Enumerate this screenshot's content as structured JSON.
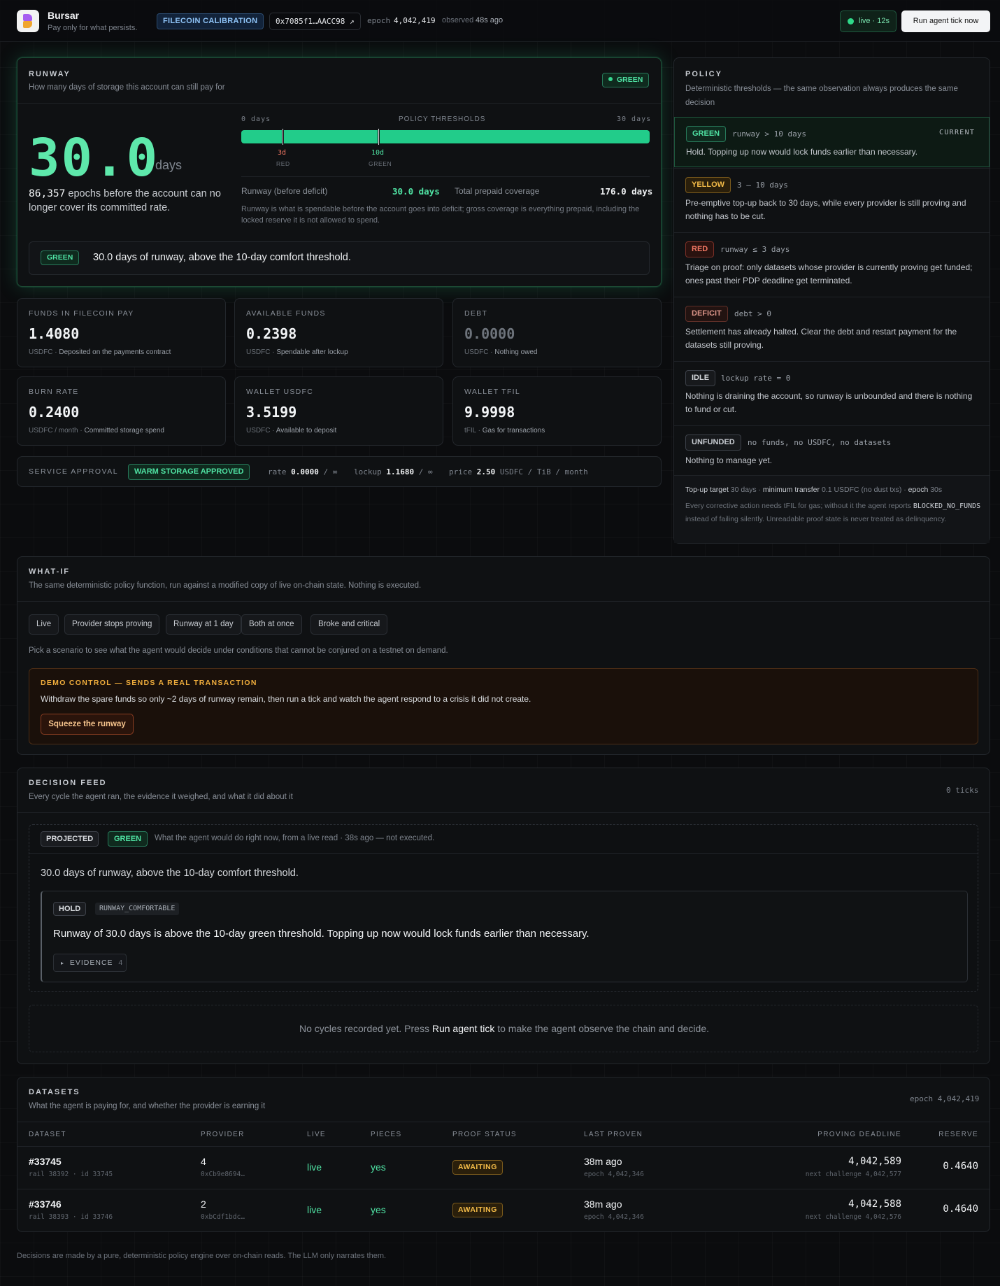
{
  "header": {
    "brand": "Bursar",
    "tagline": "Pay only for what persists.",
    "network": "FILECOIN CALIBRATION",
    "address": "0x7085f1…AACC98 ↗",
    "epoch_label": "epoch",
    "epoch": "4,042,419",
    "observed_label": "observed",
    "observed": "48s ago",
    "live": "live · 12s",
    "run_button": "Run agent tick now"
  },
  "runway": {
    "title": "RUNWAY",
    "subtitle": "How many days of storage this account can still pay for",
    "status": "GREEN",
    "days": "30.0",
    "days_unit": "days",
    "epochs": "86,357",
    "epochs_text": " epochs before the account can no longer cover its committed rate.",
    "thresholds_label": "POLICY THRESHOLDS",
    "min_label": "0 days",
    "max_label": "30 days",
    "fill_fraction": 1.0,
    "red_tick": "3d",
    "red_tick_sub": "RED",
    "green_tick": "10d",
    "green_tick_sub": "GREEN",
    "before_deficit_label": "Runway (before deficit)",
    "before_deficit": "30.0 days",
    "prepaid_label": "Total prepaid coverage",
    "prepaid": "176.0 days",
    "note": "Runway is what is spendable before the account goes into deficit; gross coverage is everything prepaid, including the locked reserve it is not allowed to spend.",
    "banner_tag": "GREEN",
    "banner_text": "30.0 days of runway, above the 10-day comfort threshold."
  },
  "stats": [
    {
      "label": "FUNDS IN FILECOIN PAY",
      "value": "1.4080",
      "unit": "USDFC",
      "desc": "Deposited on the payments contract"
    },
    {
      "label": "AVAILABLE FUNDS",
      "value": "0.2398",
      "unit": "USDFC",
      "desc": "Spendable after lockup"
    },
    {
      "label": "DEBT",
      "value": "0.0000",
      "unit": "USDFC",
      "desc": "Nothing owed"
    },
    {
      "label": "BURN RATE",
      "value": "0.2400",
      "unit": "USDFC / month",
      "desc": "Committed storage spend"
    },
    {
      "label": "WALLET USDFC",
      "value": "3.5199",
      "unit": "USDFC",
      "desc": "Available to deposit"
    },
    {
      "label": "WALLET TFIL",
      "value": "9.9998",
      "unit": "tFIL",
      "desc": "Gas for transactions"
    }
  ],
  "approval": {
    "label": "SERVICE APPROVAL",
    "tag": "WARM STORAGE APPROVED",
    "rate_label": "rate",
    "rate": "0.0000",
    "rate_max": "/ ∞",
    "lockup_label": "lockup",
    "lockup": "1.1680",
    "lockup_max": "/ ∞",
    "price_label": "price",
    "price": "2.50",
    "price_unit": "USDFC / TiB / month"
  },
  "policy": {
    "title": "POLICY",
    "subtitle": "Deterministic thresholds — the same observation always produces the same decision",
    "current_label": "CURRENT",
    "rows": [
      {
        "tag": "GREEN",
        "cond": "runway > 10 days",
        "desc": "Hold. Topping up now would lock funds earlier than necessary."
      },
      {
        "tag": "YELLOW",
        "cond": "3 – 10 days",
        "desc": "Pre-emptive top-up back to 30 days, while every provider is still proving and nothing has to be cut."
      },
      {
        "tag": "RED",
        "cond": "runway ≤ 3 days",
        "desc": "Triage on proof: only datasets whose provider is currently proving get funded; ones past their PDP deadline get terminated."
      },
      {
        "tag": "DEFICIT",
        "cond": "debt > 0",
        "desc": "Settlement has already halted. Clear the debt and restart payment for the datasets still proving."
      },
      {
        "tag": "IDLE",
        "cond": "lockup rate = 0",
        "desc": "Nothing is draining the account, so runway is unbounded and there is nothing to fund or cut."
      },
      {
        "tag": "UNFUNDED",
        "cond": "no funds, no USDFC, no datasets",
        "desc": "Nothing to manage yet."
      }
    ],
    "foot_target_label": "Top-up target",
    "foot_target": "30 days",
    "foot_min_label": "minimum transfer",
    "foot_min": "0.1 USDFC (no dust txs)",
    "foot_epoch_label": "epoch",
    "foot_epoch": "30s",
    "foot_note_a": "Every corrective action needs tFIL for gas; without it the agent reports",
    "foot_code": "BLOCKED_NO_FUNDS",
    "foot_note_b": "instead of failing silently. Unreadable proof state is never",
    "foot_note_c": "treated as delinquency."
  },
  "whatif": {
    "title": "WHAT-IF",
    "subtitle": "The same deterministic policy function, run against a modified copy of live on-chain state. Nothing is executed.",
    "scenarios": [
      "Live",
      "Provider stops proving",
      "Runway at 1 day",
      "Both at once",
      "Broke and critical"
    ],
    "hint": "Pick a scenario to see what the agent would decide under conditions that cannot be conjured on a testnet on demand.",
    "demo_title": "DEMO CONTROL — SENDS A REAL TRANSACTION",
    "demo_text": "Withdraw the spare funds so only ~2 days of runway remain, then run a tick and watch the agent respond to a crisis it did not create.",
    "demo_button": "Squeeze the runway"
  },
  "feed": {
    "title": "DECISION FEED",
    "subtitle": "Every cycle the agent ran, the evidence it weighed, and what it did about it",
    "ticks": "0 ticks",
    "projected_tag": "PROJECTED",
    "status_tag": "GREEN",
    "projected_note": "What the agent would do right now, from a live read · 38s ago — not executed.",
    "summary": "30.0 days of runway, above the 10-day comfort threshold.",
    "action": "HOLD",
    "reason_code": "RUNWAY_COMFORTABLE",
    "reason": "Runway of 30.0 days is above the 10-day green threshold. Topping up now would lock funds earlier than necessary.",
    "evidence_label": "EVIDENCE",
    "evidence_count": "4",
    "empty_a": "No cycles recorded yet. Press ",
    "empty_link": "Run agent tick",
    "empty_b": " to make the agent observe the chain and decide."
  },
  "datasets": {
    "title": "DATASETS",
    "subtitle": "What the agent is paying for, and whether the provider is earning it",
    "epoch": "epoch 4,042,419",
    "columns": [
      "DATASET",
      "PROVIDER",
      "LIVE",
      "PIECES",
      "PROOF STATUS",
      "LAST PROVEN",
      "PROVING DEADLINE",
      "RESERVE"
    ],
    "rows": [
      {
        "id": "#33745",
        "sub": "rail 38392 · id 33745",
        "provider": "4",
        "provider_addr": "0xCb9e8694…",
        "live": "live",
        "pieces": "yes",
        "proof": "AWAITING",
        "last": "38m ago",
        "last_epoch": "epoch 4,042,346",
        "deadline": "4,042,589",
        "next": "next challenge 4,042,577",
        "reserve": "0.4640"
      },
      {
        "id": "#33746",
        "sub": "rail 38393 · id 33746",
        "provider": "2",
        "provider_addr": "0xbCdf1bdc…",
        "live": "live",
        "pieces": "yes",
        "proof": "AWAITING",
        "last": "38m ago",
        "last_epoch": "epoch 4,042,346",
        "deadline": "4,042,588",
        "next": "next challenge 4,042,576",
        "reserve": "0.4640"
      }
    ]
  },
  "footer": "Decisions are made by a pure, deterministic policy engine over on-chain reads. The LLM only narrates them."
}
